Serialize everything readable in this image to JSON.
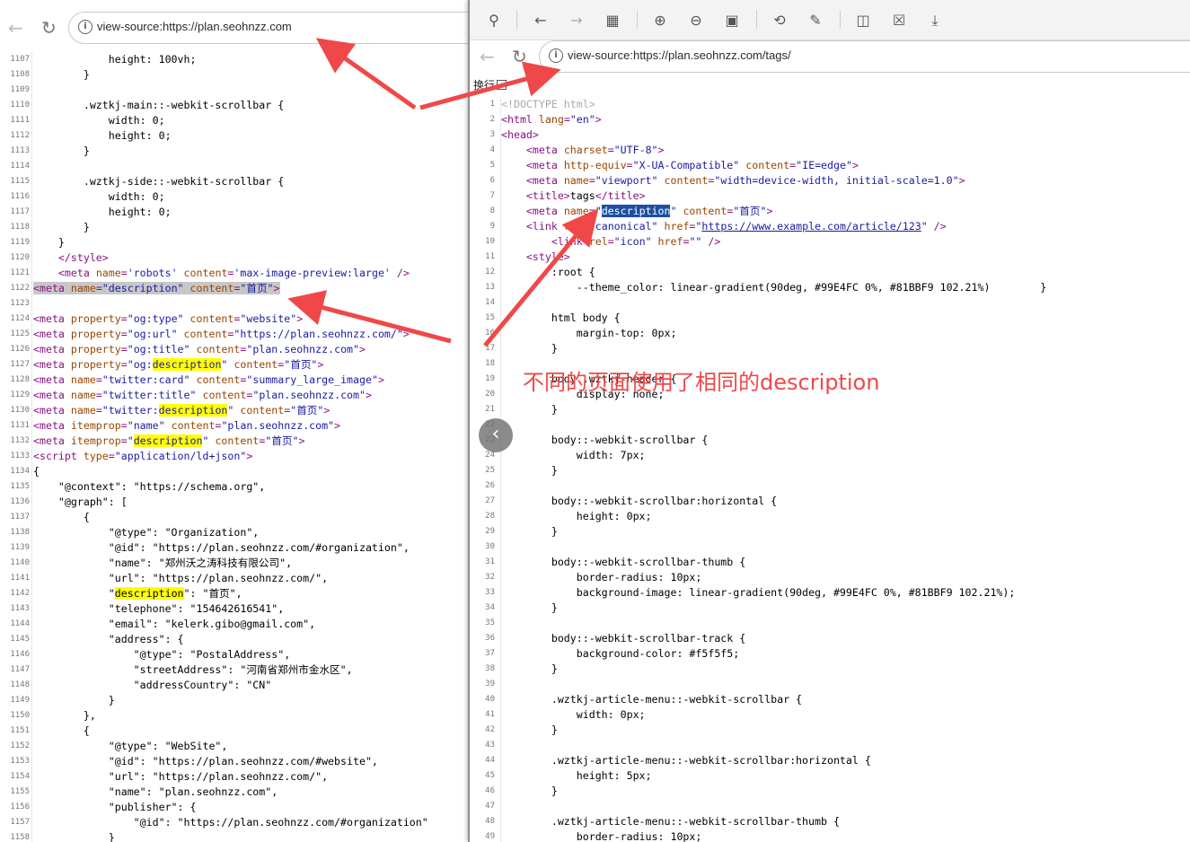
{
  "left_window": {
    "address": {
      "url": "view-source:https://plan.seohnzz.com"
    },
    "lines": [
      {
        "n": "1107",
        "html": "            height: 100vh;"
      },
      {
        "n": "1108",
        "html": "        }"
      },
      {
        "n": "1109",
        "html": ""
      },
      {
        "n": "1110",
        "html": "        .wztkj-main::-webkit-scrollbar {"
      },
      {
        "n": "1111",
        "html": "            width: 0;"
      },
      {
        "n": "1112",
        "html": "            height: 0;"
      },
      {
        "n": "1113",
        "html": "        }"
      },
      {
        "n": "1114",
        "html": ""
      },
      {
        "n": "1115",
        "html": "        .wztkj-side::-webkit-scrollbar {"
      },
      {
        "n": "1116",
        "html": "            width: 0;"
      },
      {
        "n": "1117",
        "html": "            height: 0;"
      },
      {
        "n": "1118",
        "html": "        }"
      },
      {
        "n": "1119",
        "html": "    }"
      },
      {
        "n": "1120",
        "html": "    <span class=\"t\">&lt;/style&gt;</span>"
      },
      {
        "n": "1121",
        "html": "    <span class=\"t\">&lt;meta <span class=\"a\">name</span>=<span class=\"v\">'robots'</span> <span class=\"a\">content</span>=<span class=\"v\">'max-image-preview:large'</span> /&gt;</span>"
      },
      {
        "n": "1122",
        "html": "<span class=\"gry\"><span class=\"t\">&lt;meta <span class=\"a\">name</span>=<span class=\"v\">\"description\"</span> <span class=\"a\">content</span>=<span class=\"v\">\"首页\"</span>&gt;</span></span>"
      },
      {
        "n": "1123",
        "html": ""
      },
      {
        "n": "1124",
        "html": "<span class=\"t\">&lt;meta <span class=\"a\">property</span>=<span class=\"v\">\"og:type\"</span> <span class=\"a\">content</span>=<span class=\"v\">\"website\"</span>&gt;</span>"
      },
      {
        "n": "1125",
        "html": "<span class=\"t\">&lt;meta <span class=\"a\">property</span>=<span class=\"v\">\"og:url\"</span> <span class=\"a\">content</span>=<span class=\"v\">\"https://plan.seohnzz.com/\"</span>&gt;</span>"
      },
      {
        "n": "1126",
        "html": "<span class=\"t\">&lt;meta <span class=\"a\">property</span>=<span class=\"v\">\"og:title\"</span> <span class=\"a\">content</span>=<span class=\"v\">\"plan.seohnzz.com\"</span>&gt;</span>"
      },
      {
        "n": "1127",
        "html": "<span class=\"t\">&lt;meta <span class=\"a\">property</span>=<span class=\"v\">\"og:<span class=\"hl\">description</span>\"</span> <span class=\"a\">content</span>=<span class=\"v\">\"首页\"</span>&gt;</span>"
      },
      {
        "n": "1128",
        "html": "<span class=\"t\">&lt;meta <span class=\"a\">name</span>=<span class=\"v\">\"twitter:card\"</span> <span class=\"a\">content</span>=<span class=\"v\">\"summary_large_image\"</span>&gt;</span>"
      },
      {
        "n": "1129",
        "html": "<span class=\"t\">&lt;meta <span class=\"a\">name</span>=<span class=\"v\">\"twitter:title\"</span> <span class=\"a\">content</span>=<span class=\"v\">\"plan.seohnzz.com\"</span>&gt;</span>"
      },
      {
        "n": "1130",
        "html": "<span class=\"t\">&lt;meta <span class=\"a\">name</span>=<span class=\"v\">\"twitter:<span class=\"hl\">description</span>\"</span> <span class=\"a\">content</span>=<span class=\"v\">\"首页\"</span>&gt;</span>"
      },
      {
        "n": "1131",
        "html": "<span class=\"t\">&lt;meta <span class=\"a\">itemprop</span>=<span class=\"v\">\"name\"</span> <span class=\"a\">content</span>=<span class=\"v\">\"plan.seohnzz.com\"</span>&gt;</span>"
      },
      {
        "n": "1132",
        "html": "<span class=\"t\">&lt;meta <span class=\"a\">itemprop</span>=<span class=\"v\">\"<span class=\"hl\">description</span>\"</span> <span class=\"a\">content</span>=<span class=\"v\">\"首页\"</span>&gt;</span>"
      },
      {
        "n": "1133",
        "html": "<span class=\"t\">&lt;script <span class=\"a\">type</span>=<span class=\"v\">\"application/ld+json\"</span>&gt;</span>"
      },
      {
        "n": "1134",
        "html": "{"
      },
      {
        "n": "1135",
        "html": "    \"@context\": \"https://schema.org\","
      },
      {
        "n": "1136",
        "html": "    \"@graph\": ["
      },
      {
        "n": "1137",
        "html": "        {"
      },
      {
        "n": "1138",
        "html": "            \"@type\": \"Organization\","
      },
      {
        "n": "1139",
        "html": "            \"@id\": \"https://plan.seohnzz.com/#organization\","
      },
      {
        "n": "1140",
        "html": "            \"name\": \"郑州沃之涛科技有限公司\","
      },
      {
        "n": "1141",
        "html": "            \"url\": \"https://plan.seohnzz.com/\","
      },
      {
        "n": "1142",
        "html": "            \"<span class=\"hl\">description</span>\": \"首页\","
      },
      {
        "n": "1143",
        "html": "            \"telephone\": \"154642616541\","
      },
      {
        "n": "1144",
        "html": "            \"email\": \"kelerk.gibo@gmail.com\","
      },
      {
        "n": "1145",
        "html": "            \"address\": {"
      },
      {
        "n": "1146",
        "html": "                \"@type\": \"PostalAddress\","
      },
      {
        "n": "1147",
        "html": "                \"streetAddress\": \"河南省郑州市金水区\","
      },
      {
        "n": "1148",
        "html": "                \"addressCountry\": \"CN\""
      },
      {
        "n": "1149",
        "html": "            }"
      },
      {
        "n": "1150",
        "html": "        },"
      },
      {
        "n": "1151",
        "html": "        {"
      },
      {
        "n": "1152",
        "html": "            \"@type\": \"WebSite\","
      },
      {
        "n": "1153",
        "html": "            \"@id\": \"https://plan.seohnzz.com/#website\","
      },
      {
        "n": "1154",
        "html": "            \"url\": \"https://plan.seohnzz.com/\","
      },
      {
        "n": "1155",
        "html": "            \"name\": \"plan.seohnzz.com\","
      },
      {
        "n": "1156",
        "html": "            \"publisher\": {"
      },
      {
        "n": "1157",
        "html": "                \"@id\": \"https://plan.seohnzz.com/#organization\""
      },
      {
        "n": "1158",
        "html": "            }"
      }
    ]
  },
  "right_window": {
    "address": {
      "url": "view-source:https://plan.seohnzz.com/tags/"
    },
    "wrap_label": "换行",
    "toolbar_icons": [
      "pin-icon",
      "back-icon",
      "forward-icon",
      "grid-icon",
      "zoom-in-icon",
      "zoom-out-icon",
      "fit-icon",
      "rotate-icon",
      "edit-icon",
      "translate-icon",
      "close-box-icon",
      "save-icon"
    ],
    "annotation": "不同的页面使用了相同的description",
    "lines": [
      {
        "n": "1",
        "html": "<span class=\"c\" style=\"color:#aaa\">&lt;!DOCTYPE html&gt;</span>"
      },
      {
        "n": "2",
        "html": "<span class=\"t\">&lt;html <span class=\"a\">lang</span>=<span class=\"v\">\"en\"</span>&gt;</span>"
      },
      {
        "n": "3",
        "html": "<span class=\"t\">&lt;head&gt;</span>"
      },
      {
        "n": "4",
        "html": "    <span class=\"t\">&lt;meta <span class=\"a\">charset</span>=<span class=\"v\">\"UTF-8\"</span>&gt;</span>"
      },
      {
        "n": "5",
        "html": "    <span class=\"t\">&lt;meta <span class=\"a\">http-equiv</span>=<span class=\"v\">\"X-UA-Compatible\"</span> <span class=\"a\">content</span>=<span class=\"v\">\"IE=edge\"</span>&gt;</span>"
      },
      {
        "n": "6",
        "html": "    <span class=\"t\">&lt;meta <span class=\"a\">name</span>=<span class=\"v\">\"viewport\"</span> <span class=\"a\">content</span>=<span class=\"v\">\"width=device-width, initial-scale=1.0\"</span>&gt;</span>"
      },
      {
        "n": "7",
        "html": "    <span class=\"t\">&lt;title&gt;</span>tags<span class=\"t\">&lt;/title&gt;</span>"
      },
      {
        "n": "8",
        "html": "    <span class=\"t\">&lt;meta <span class=\"a\">name</span>=<span class=\"v\">\"<span class=\"sel\">description</span>\"</span> <span class=\"a\">content</span>=<span class=\"v\">\"首页\"</span>&gt;</span>"
      },
      {
        "n": "9",
        "html": "    <span class=\"t\">&lt;link <span class=\"a\">rel</span>=<span class=\"v\">\"canonical\"</span> <span class=\"a\">href</span>=<span class=\"v\">\"<span class=\"lnk\">https://www.example.com/article/123</span>\"</span> /&gt;</span>"
      },
      {
        "n": "10",
        "html": "        <span class=\"t\">&lt;link <span class=\"a\">rel</span>=<span class=\"v\">\"icon\"</span> <span class=\"a\">href</span>=<span class=\"v\">\"\"</span> /&gt;</span>"
      },
      {
        "n": "11",
        "html": "    <span class=\"t\">&lt;style&gt;</span>"
      },
      {
        "n": "12",
        "html": "        :root {"
      },
      {
        "n": "13",
        "html": "            --theme_color: linear-gradient(90deg, #99E4FC 0%, #81BBF9 102.21%)        }"
      },
      {
        "n": "14",
        "html": ""
      },
      {
        "n": "15",
        "html": "        html body {"
      },
      {
        "n": "16",
        "html": "            margin-top: 0px;"
      },
      {
        "n": "17",
        "html": "        }"
      },
      {
        "n": "18",
        "html": ""
      },
      {
        "n": "19",
        "html": "        body .wztkj-header {"
      },
      {
        "n": "20",
        "html": "            display: none;"
      },
      {
        "n": "21",
        "html": "        }"
      },
      {
        "n": "22",
        "html": ""
      },
      {
        "n": "23",
        "html": "        body::-webkit-scrollbar {"
      },
      {
        "n": "24",
        "html": "            width: 7px;"
      },
      {
        "n": "25",
        "html": "        }"
      },
      {
        "n": "26",
        "html": ""
      },
      {
        "n": "27",
        "html": "        body::-webkit-scrollbar:horizontal {"
      },
      {
        "n": "28",
        "html": "            height: 0px;"
      },
      {
        "n": "29",
        "html": "        }"
      },
      {
        "n": "30",
        "html": ""
      },
      {
        "n": "31",
        "html": "        body::-webkit-scrollbar-thumb {"
      },
      {
        "n": "32",
        "html": "            border-radius: 10px;"
      },
      {
        "n": "33",
        "html": "            background-image: linear-gradient(90deg, #99E4FC 0%, #81BBF9 102.21%);"
      },
      {
        "n": "34",
        "html": "        }"
      },
      {
        "n": "35",
        "html": ""
      },
      {
        "n": "36",
        "html": "        body::-webkit-scrollbar-track {"
      },
      {
        "n": "37",
        "html": "            background-color: #f5f5f5;"
      },
      {
        "n": "38",
        "html": "        }"
      },
      {
        "n": "39",
        "html": ""
      },
      {
        "n": "40",
        "html": "        .wztkj-article-menu::-webkit-scrollbar {"
      },
      {
        "n": "41",
        "html": "            width: 0px;"
      },
      {
        "n": "42",
        "html": "        }"
      },
      {
        "n": "43",
        "html": ""
      },
      {
        "n": "44",
        "html": "        .wztkj-article-menu::-webkit-scrollbar:horizontal {"
      },
      {
        "n": "45",
        "html": "            height: 5px;"
      },
      {
        "n": "46",
        "html": "        }"
      },
      {
        "n": "47",
        "html": ""
      },
      {
        "n": "48",
        "html": "        .wztkj-article-menu::-webkit-scrollbar-thumb {"
      },
      {
        "n": "49",
        "html": "            border-radius: 10px;"
      }
    ]
  },
  "colors": {
    "arrow": "#f04848",
    "highlight": "#ffff00",
    "selection": "#1c4fa3"
  }
}
